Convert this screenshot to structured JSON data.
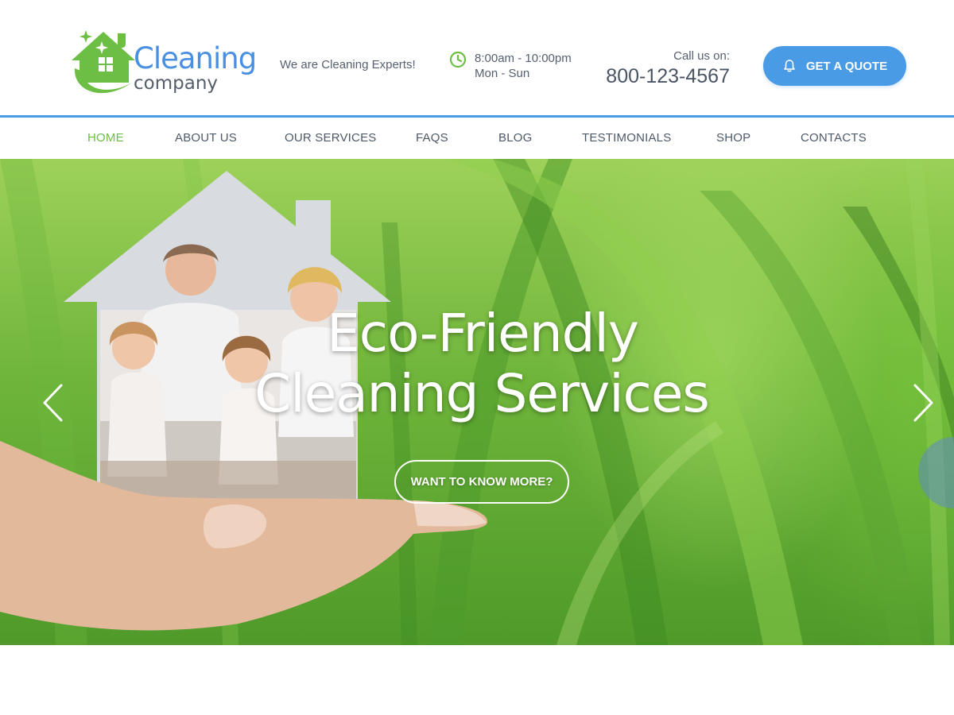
{
  "brand": {
    "word": "Cleaning",
    "sub": "company",
    "tagline": "We are Cleaning Experts!"
  },
  "hours": {
    "time": "8:00am - 10:00pm",
    "days": "Mon - Sun",
    "icon": "clock-icon"
  },
  "contact": {
    "label": "Call us on:",
    "phone": "800-123-4567"
  },
  "quote_button": {
    "label": "GET A QUOTE",
    "icon": "bell-icon"
  },
  "nav": {
    "items": [
      {
        "label": "HOME",
        "active": true
      },
      {
        "label": "ABOUT US"
      },
      {
        "label": "OUR SERVICES"
      },
      {
        "label": "FAQS"
      },
      {
        "label": "BLOG"
      },
      {
        "label": "TESTIMONIALS"
      },
      {
        "label": "SHOP"
      },
      {
        "label": "CONTACTS"
      }
    ]
  },
  "hero": {
    "title_line1": "Eco-Friendly",
    "title_line2": "Cleaning Services",
    "button": "WANT TO KNOW MORE?",
    "prev_icon": "chevron-left-icon",
    "next_icon": "chevron-right-icon"
  },
  "colors": {
    "accent_blue": "#4a9be6",
    "accent_green": "#6cbf44",
    "text": "#4e5968"
  }
}
